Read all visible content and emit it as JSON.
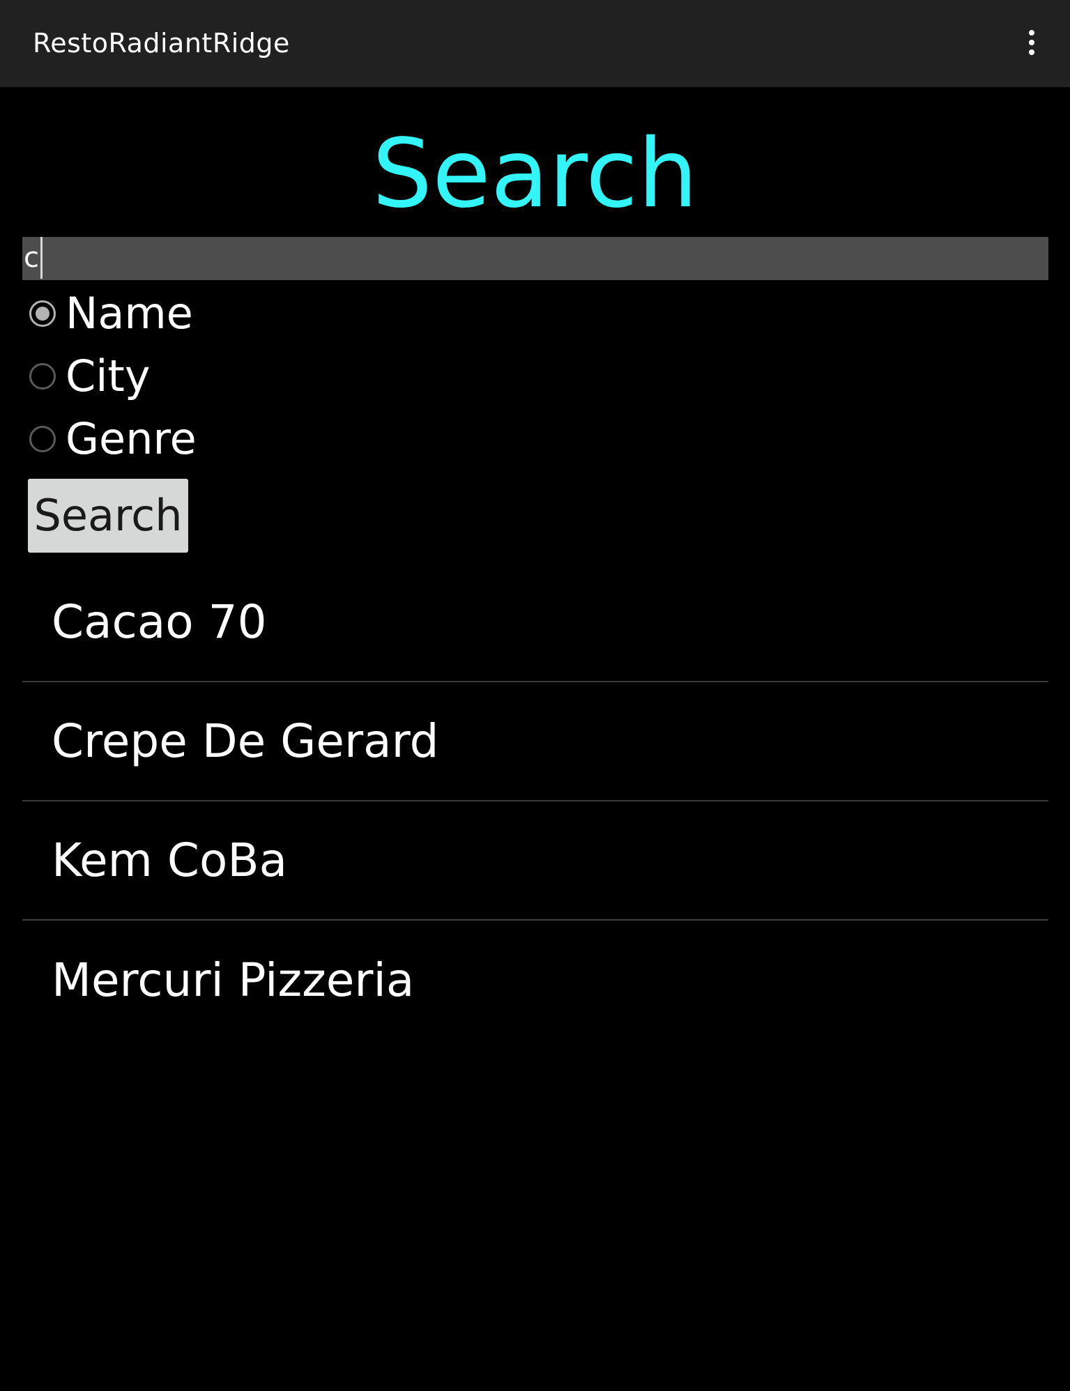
{
  "appbar": {
    "title": "RestoRadiantRidge",
    "menu_icon": "more-vert-icon"
  },
  "page": {
    "heading": "Search"
  },
  "search": {
    "value": "c"
  },
  "filters": {
    "options": [
      {
        "label": "Name",
        "checked": true
      },
      {
        "label": "City",
        "checked": false
      },
      {
        "label": "Genre",
        "checked": false
      }
    ]
  },
  "actions": {
    "search_label": "Search"
  },
  "results": {
    "items": [
      "Cacao 70",
      "Crepe De Gerard",
      "Kem CoBa",
      "Mercuri Pizzeria"
    ]
  },
  "colors": {
    "accent": "#33f5f8",
    "appbar": "#212121",
    "background": "#000000",
    "input_background": "#4d4d4d",
    "button_background": "#d6d7d7"
  }
}
